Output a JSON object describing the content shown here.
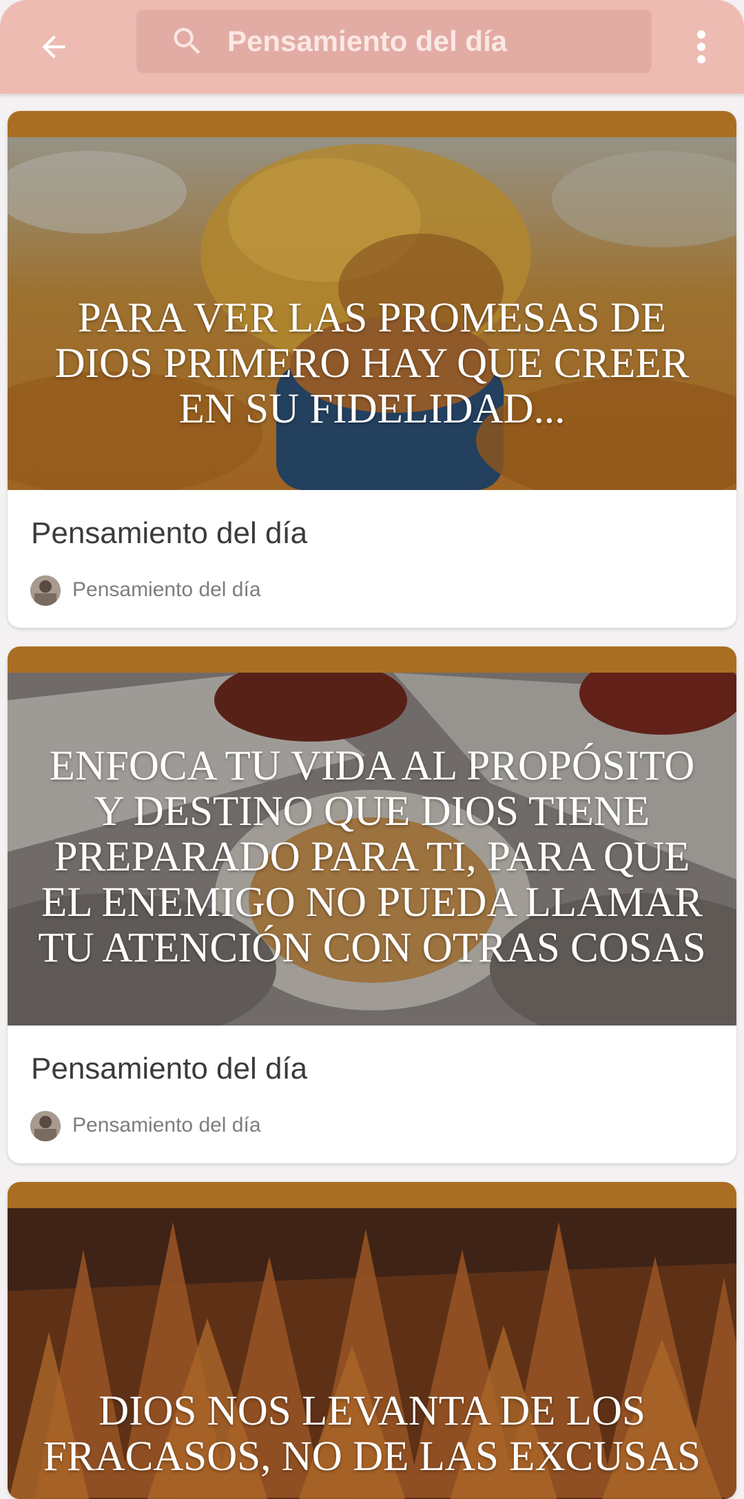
{
  "search": {
    "placeholder": "Pensamiento del día"
  },
  "icons": {
    "back": "arrow-back-icon",
    "search": "search-icon",
    "menu": "more-vert-icon"
  },
  "colors": {
    "toolbar": "#eebbb2",
    "search_box": "#e2aca5",
    "card_band": "#aa6e23"
  },
  "cards": [
    {
      "quote": "PARA VER LAS PROMESAS DE DIOS PRIMERO HAY QUE CREER EN SU FIDELIDAD...",
      "title": "Pensamiento del día",
      "author": "Pensamiento del día"
    },
    {
      "quote": "ENFOCA TU VIDA AL PROPÓSITO Y DESTINO QUE DIOS TIENE PREPARADO PARA TI, PARA QUE EL ENEMIGO NO PUEDA LLAMAR TU ATENCIÓN CON OTRAS COSAS",
      "title": "Pensamiento del día",
      "author": "Pensamiento del día"
    },
    {
      "quote": "DIOS NOS LEVANTA DE LOS FRACASOS, NO DE LAS EXCUSAS"
    }
  ]
}
